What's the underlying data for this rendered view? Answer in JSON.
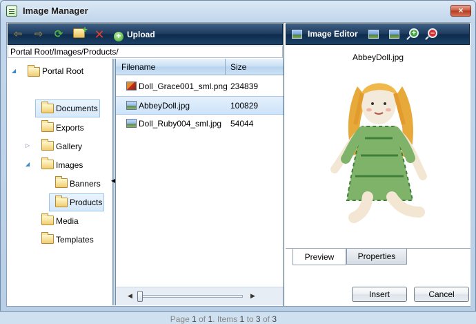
{
  "window": {
    "title": "Image Manager",
    "close_label": "×"
  },
  "browser_toolbar": {
    "upload_label": "Upload",
    "upload_icon": "+"
  },
  "path": "Portal Root/Images/Products/",
  "tree": {
    "root": "Portal Root",
    "documents": "Documents",
    "exports": "Exports",
    "gallery": "Gallery",
    "images": "Images",
    "banners": "Banners",
    "products": "Products",
    "media": "Media",
    "templates": "Templates"
  },
  "grid": {
    "col_filename": "Filename",
    "col_size": "Size",
    "rows": [
      {
        "name": "Doll_Grace001_sml.png",
        "size": "234839"
      },
      {
        "name": "AbbeyDoll.jpg",
        "size": "100829"
      },
      {
        "name": "Doll_Ruby004_sml.jpg",
        "size": "54044"
      }
    ],
    "pager": {
      "page_word": "Page",
      "page": "1",
      "of_word": "of",
      "pages": "1",
      "items_word": ". Items",
      "from": "1",
      "to_word": "to",
      "to": "3",
      "of2_word": "of",
      "total": "3"
    }
  },
  "editor": {
    "title": "Image Editor",
    "file_name": "AbbeyDoll.jpg",
    "tab_preview": "Preview",
    "tab_properties": "Properties",
    "insert_label": "Insert",
    "cancel_label": "Cancel"
  }
}
